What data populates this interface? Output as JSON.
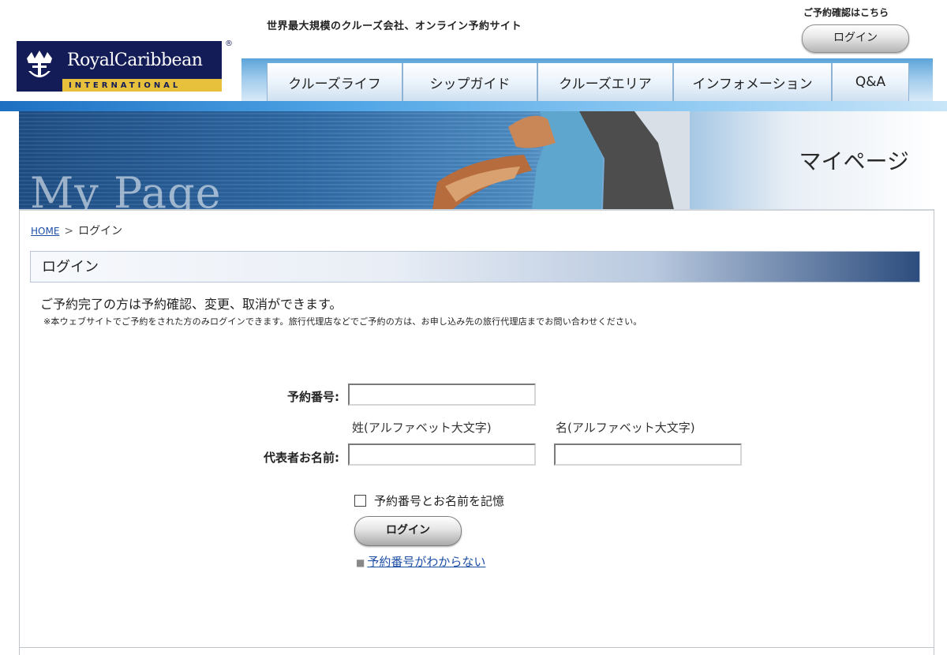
{
  "header": {
    "tagline": "世界最大規模のクルーズ会社、オンライン予約サイト",
    "confirm_text": "ご予約確認はこちら",
    "login_button": "ログイン",
    "logo_name": "RoyalCaribbean",
    "logo_sub": "INTERNATIONAL",
    "logo_reg": "®"
  },
  "nav": {
    "items": [
      {
        "label": "クルーズライフ"
      },
      {
        "label": "シップガイド"
      },
      {
        "label": "クルーズエリア"
      },
      {
        "label": "インフォメーション"
      },
      {
        "label": "Q&A"
      }
    ]
  },
  "banner": {
    "bg_text": "My Page",
    "title": "マイページ"
  },
  "breadcrumb": {
    "home": "HOME",
    "separator": ">",
    "current": "ログイン"
  },
  "section": {
    "title": "ログイン",
    "description": "ご予約完了の方は予約確認、変更、取消ができます。",
    "note": "※本ウェブサイトでご予約をされた方のみログインできます。旅行代理店などでご予約の方は、お申し込み先の旅行代理店までお問い合わせください。"
  },
  "form": {
    "reservation_label": "予約番号:",
    "reservation_value": "",
    "name_label": "代表者お名前:",
    "last_name_caption": "姓(アルファベット大文字)",
    "first_name_caption": "名(アルファベット大文字)",
    "last_name_value": "",
    "first_name_value": "",
    "remember_label": "予約番号とお名前を記憶",
    "remember_checked": false,
    "login_button": "ログイン",
    "forgot_bullet": "■",
    "forgot_link": "予約番号がわからない"
  },
  "colors": {
    "brand_navy": "#141c57",
    "brand_gold": "#e7c13b",
    "link_blue": "#1d4fa6"
  }
}
